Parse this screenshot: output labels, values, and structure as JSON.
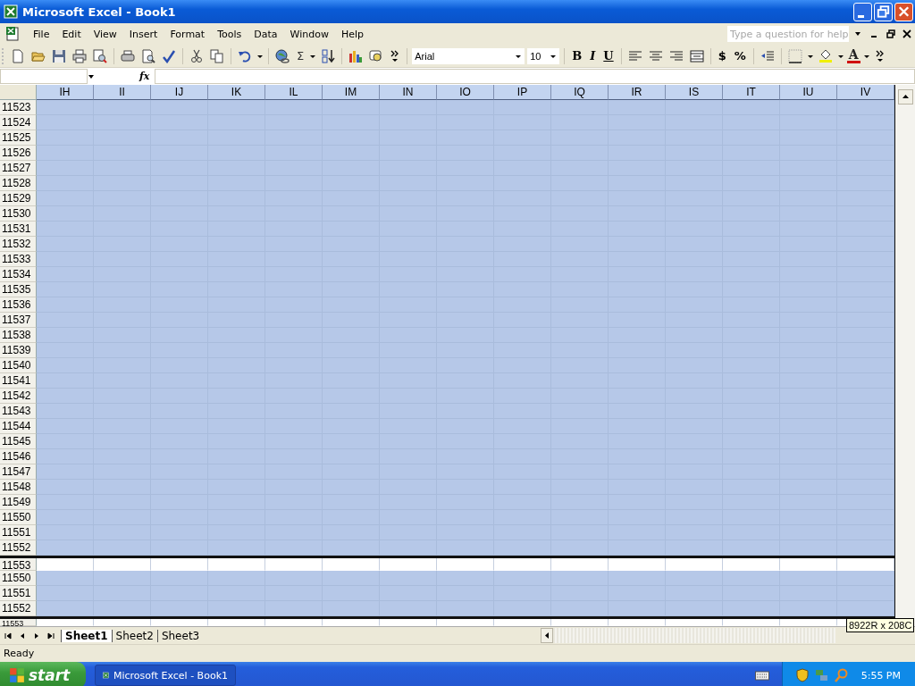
{
  "window": {
    "title": "Microsoft Excel - Book1"
  },
  "menu": [
    "File",
    "Edit",
    "View",
    "Insert",
    "Format",
    "Tools",
    "Data",
    "Window",
    "Help"
  ],
  "help_box": {
    "placeholder": "Type a question for help"
  },
  "toolbar": {
    "sum": "Σ",
    "font": "Arial",
    "size": "10",
    "format_buttons": [
      "B",
      "I",
      "U"
    ],
    "currency": "$",
    "percent": "%",
    "font_color": "A"
  },
  "formula_bar": {
    "fx": "fx"
  },
  "columns": [
    "IH",
    "II",
    "IJ",
    "IK",
    "IL",
    "IM",
    "IN",
    "IO",
    "IP",
    "IQ",
    "IR",
    "IS",
    "IT",
    "IU",
    "IV"
  ],
  "rows": [
    {
      "label": "11523",
      "selected": true
    },
    {
      "label": "11524",
      "selected": true
    },
    {
      "label": "11525",
      "selected": true
    },
    {
      "label": "11526",
      "selected": true
    },
    {
      "label": "11527",
      "selected": true
    },
    {
      "label": "11528",
      "selected": true
    },
    {
      "label": "11529",
      "selected": true
    },
    {
      "label": "11530",
      "selected": true
    },
    {
      "label": "11531",
      "selected": true
    },
    {
      "label": "11532",
      "selected": true
    },
    {
      "label": "11533",
      "selected": true
    },
    {
      "label": "11534",
      "selected": true
    },
    {
      "label": "11535",
      "selected": true
    },
    {
      "label": "11536",
      "selected": true
    },
    {
      "label": "11537",
      "selected": true
    },
    {
      "label": "11538",
      "selected": true
    },
    {
      "label": "11539",
      "selected": true
    },
    {
      "label": "11540",
      "selected": true
    },
    {
      "label": "11541",
      "selected": true
    },
    {
      "label": "11542",
      "selected": true
    },
    {
      "label": "11543",
      "selected": true
    },
    {
      "label": "11544",
      "selected": true
    },
    {
      "label": "11545",
      "selected": true
    },
    {
      "label": "11546",
      "selected": true
    },
    {
      "label": "11547",
      "selected": true
    },
    {
      "label": "11548",
      "selected": true
    },
    {
      "label": "11549",
      "selected": true
    },
    {
      "label": "11550",
      "selected": true
    },
    {
      "label": "11551",
      "selected": true
    },
    {
      "label": "11552",
      "selected": true
    },
    {
      "label": "11553",
      "selected": false
    },
    {
      "label": "11550",
      "selected": true
    },
    {
      "label": "11551",
      "selected": true
    },
    {
      "label": "11552",
      "selected": true
    },
    {
      "label": "11553",
      "selected": false
    }
  ],
  "sheet_tabs": [
    {
      "label": "Sheet1",
      "selected": true
    },
    {
      "label": "Sheet2",
      "selected": false
    },
    {
      "label": "Sheet3",
      "selected": false
    }
  ],
  "selection_tooltip": "8922R x 208C",
  "status_bar": "Ready",
  "taskbar": {
    "start": "start",
    "task": "Microsoft Excel - Book1",
    "clock": "5:55 PM"
  }
}
